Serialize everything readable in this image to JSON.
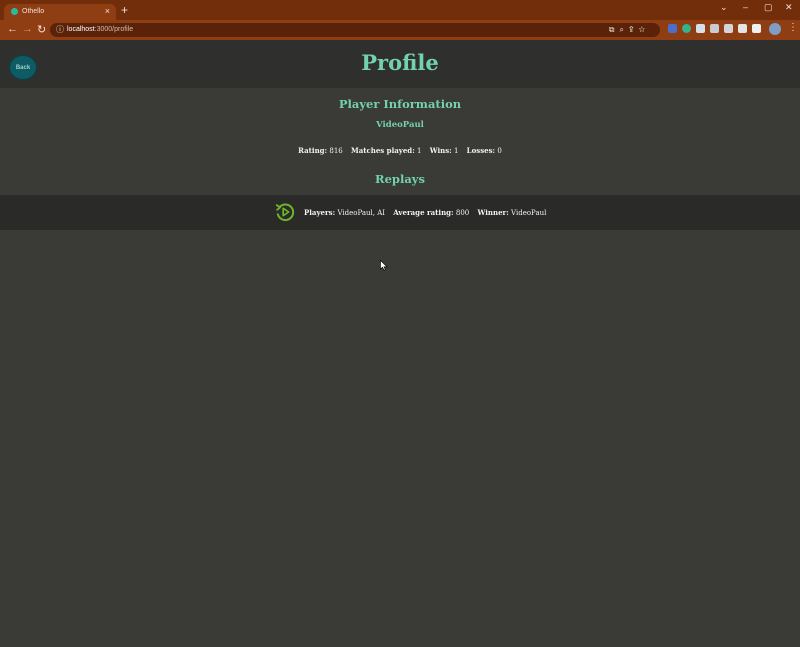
{
  "browser": {
    "tab_title": "Othello",
    "tab_close": "×",
    "new_tab": "+",
    "url_host": "localhost",
    "url_path": ":3000/profile",
    "window_controls": [
      "⌄",
      "–",
      "▢",
      "✕"
    ]
  },
  "header": {
    "back_label": "Back",
    "title": "Profile"
  },
  "player_section": {
    "title": "Player Information",
    "name": "VideoPaul",
    "stats": [
      {
        "label": "Rating:",
        "value": "816"
      },
      {
        "label": "Matches played:",
        "value": "1"
      },
      {
        "label": "Wins:",
        "value": "1"
      },
      {
        "label": "Losses:",
        "value": "0"
      }
    ]
  },
  "replays_section": {
    "title": "Replays",
    "replays": [
      {
        "players_label": "Players:",
        "players_value": "VideoPaul, AI",
        "avg_label": "Average rating:",
        "avg_value": "800",
        "winner_label": "Winner:",
        "winner_value": "VideoPaul",
        "icon": "replay-icon"
      }
    ]
  },
  "colors": {
    "accent": "#74d1b0",
    "replay_icon": "#6fb52c",
    "page_bg": "#3a3a37",
    "header_bg": "#2f302e",
    "chrome": "#8f3d12"
  }
}
